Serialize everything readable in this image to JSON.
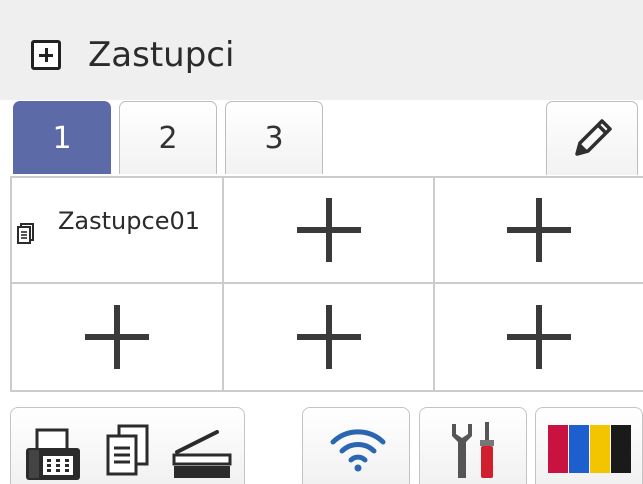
{
  "header": {
    "title": "Zastupci",
    "icon": "add-shortcut-icon"
  },
  "tabs": [
    {
      "label": "1",
      "active": true
    },
    {
      "label": "2",
      "active": false
    },
    {
      "label": "3",
      "active": false
    }
  ],
  "edit": {
    "icon": "pencil-icon"
  },
  "shortcuts": {
    "first": {
      "label": "Zastupce01",
      "icon": "document-icon"
    },
    "empty_icon": "plus-icon"
  },
  "bottom_bar": {
    "functions": [
      "fax-icon",
      "copy-icon",
      "scan-icon"
    ],
    "wifi": "wifi-icon",
    "settings": "tools-icon",
    "toner": "toner-icon"
  },
  "colors": {
    "active_tab": "#5d6aa8",
    "wifi": "#2b67b0",
    "toner_magenta": "#c8123f",
    "toner_cyan": "#1d5fcf",
    "toner_yellow": "#f3c400",
    "toner_black": "#1a1a1a"
  }
}
